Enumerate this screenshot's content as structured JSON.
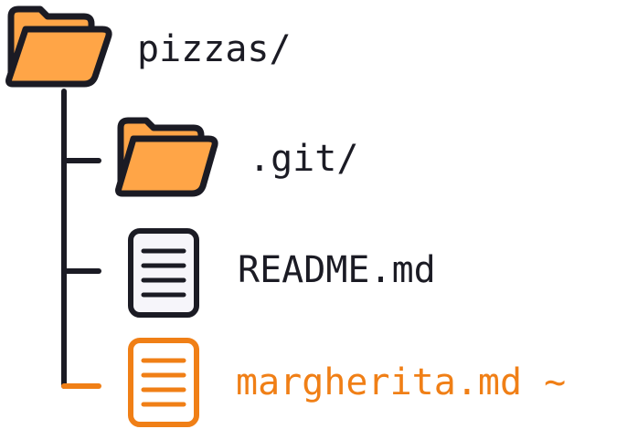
{
  "colors": {
    "ink": "#1b1b24",
    "folder_fill": "#ffa547",
    "file_fill": "#f6f5fa",
    "modified": "#f07f16"
  },
  "tree": {
    "root": {
      "name": "pizzas/",
      "icon": "folder-icon"
    },
    "children": [
      {
        "name": ".git/",
        "icon": "folder-icon",
        "modified": false
      },
      {
        "name": "README.md",
        "icon": "file-icon",
        "modified": false
      },
      {
        "name": "margherita.md ~",
        "icon": "file-icon",
        "modified": true
      }
    ]
  }
}
